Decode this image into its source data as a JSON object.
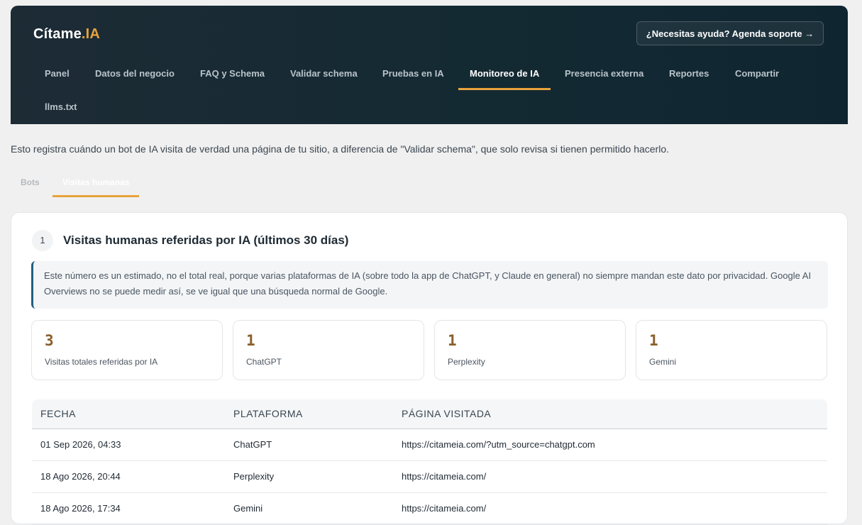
{
  "header": {
    "logo_main": "Cítame",
    "logo_accent": ".IA",
    "help_button": "¿Necesitas ayuda? Agenda soporte →",
    "nav": [
      {
        "label": "Panel"
      },
      {
        "label": "Datos del negocio"
      },
      {
        "label": "FAQ y Schema"
      },
      {
        "label": "Validar schema"
      },
      {
        "label": "Pruebas en IA"
      },
      {
        "label": "Monitoreo de IA",
        "active": true
      },
      {
        "label": "Presencia externa"
      },
      {
        "label": "Reportes"
      },
      {
        "label": "Compartir"
      },
      {
        "label": "llms.txt"
      }
    ]
  },
  "intro_text": "Esto registra cuándo un bot de IA visita de verdad una página de tu sitio, a diferencia de \"Validar schema\", que solo revisa si tienen permitido hacerlo.",
  "subtabs": [
    {
      "label": "Bots"
    },
    {
      "label": "Visitas humanas",
      "active": true
    }
  ],
  "section": {
    "step": "1",
    "title": "Visitas humanas referidas por IA (últimos 30 días)",
    "notice": "Este número es un estimado, no el total real, porque varias plataformas de IA (sobre todo la app de ChatGPT, y Claude en general) no siempre mandan este dato por privacidad. Google AI Overviews no se puede medir así, se ve igual que una búsqueda normal de Google."
  },
  "stats": [
    {
      "value": "3",
      "label": "Visitas totales referidas por IA"
    },
    {
      "value": "1",
      "label": "ChatGPT"
    },
    {
      "value": "1",
      "label": "Perplexity"
    },
    {
      "value": "1",
      "label": "Gemini"
    }
  ],
  "table": {
    "headers": [
      "FECHA",
      "PLATAFORMA",
      "PÁGINA VISITADA"
    ],
    "rows": [
      [
        "01 Sep 2026, 04:33",
        "ChatGPT",
        "https://citameia.com/?utm_source=chatgpt.com"
      ],
      [
        "18 Ago 2026, 20:44",
        "Perplexity",
        "https://citameia.com/"
      ],
      [
        "18 Ago 2026, 17:34",
        "Gemini",
        "https://citameia.com/"
      ]
    ]
  },
  "colors": {
    "accent": "#e9a23b",
    "header_bg": "#142a33",
    "stat_value": "#8a5f2b",
    "notice_border": "#23607f"
  }
}
